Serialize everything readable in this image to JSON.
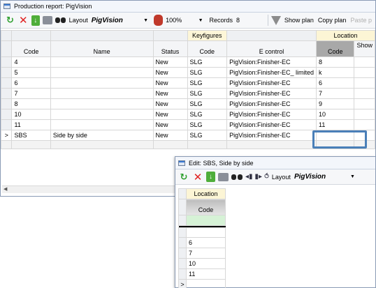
{
  "main_window": {
    "title": "Production report: PigVision",
    "toolbar": {
      "layout_label": "Layout",
      "layout_value": "PigVision",
      "zoom_value": "100%",
      "records_label": "Records",
      "records_value": "8",
      "show_plan": "Show plan",
      "copy_plan": "Copy plan",
      "paste_plan": "Paste p"
    },
    "grid": {
      "group_headers": {
        "keyfigures": "Keyfigures",
        "location": "Location"
      },
      "columns": [
        "Code",
        "Name",
        "Status",
        "Code",
        "E control",
        "Code",
        "Show"
      ],
      "rows": [
        {
          "code": "4",
          "name": "",
          "status": "New",
          "kf_code": "SLG",
          "e_control": "PigVision:Finisher-EC",
          "loc_code": "8"
        },
        {
          "code": "5",
          "name": "",
          "status": "New",
          "kf_code": "SLG",
          "e_control": "PigVision:Finisher-EC_ limited",
          "loc_code": "k"
        },
        {
          "code": "6",
          "name": "",
          "status": "New",
          "kf_code": "SLG",
          "e_control": "PigVision:Finisher-EC",
          "loc_code": "6"
        },
        {
          "code": "7",
          "name": "",
          "status": "New",
          "kf_code": "SLG",
          "e_control": "PigVision:Finisher-EC",
          "loc_code": "7"
        },
        {
          "code": "8",
          "name": "",
          "status": "New",
          "kf_code": "SLG",
          "e_control": "PigVision:Finisher-EC",
          "loc_code": "9"
        },
        {
          "code": "10",
          "name": "",
          "status": "New",
          "kf_code": "SLG",
          "e_control": "PigVision:Finisher-EC",
          "loc_code": "10"
        },
        {
          "code": "11",
          "name": "",
          "status": "New",
          "kf_code": "SLG",
          "e_control": "PigVision:Finisher-EC",
          "loc_code": "11"
        },
        {
          "code": "SBS",
          "name": "Side by side",
          "status": "New",
          "kf_code": "SLG",
          "e_control": "PigVision:Finisher-EC",
          "loc_code": ""
        }
      ],
      "selected_row_marker": ">"
    }
  },
  "edit_window": {
    "title": "Edit: SBS, Side by side",
    "toolbar": {
      "layout_label": "Layout",
      "layout_value": "PigVision"
    },
    "grid": {
      "group_header": "Location",
      "column": "Code",
      "rows": [
        "6",
        "7",
        "10",
        "11"
      ],
      "row_marker": ">"
    }
  },
  "colors": {
    "location_header": "#fcf5d5",
    "new_row": "#d6f2d6",
    "focus_outline": "#4a7fb8"
  },
  "icons": [
    "refresh-icon",
    "close-icon",
    "export-icon",
    "print-icon",
    "binoculars-icon",
    "bug-icon",
    "funnel-icon"
  ]
}
